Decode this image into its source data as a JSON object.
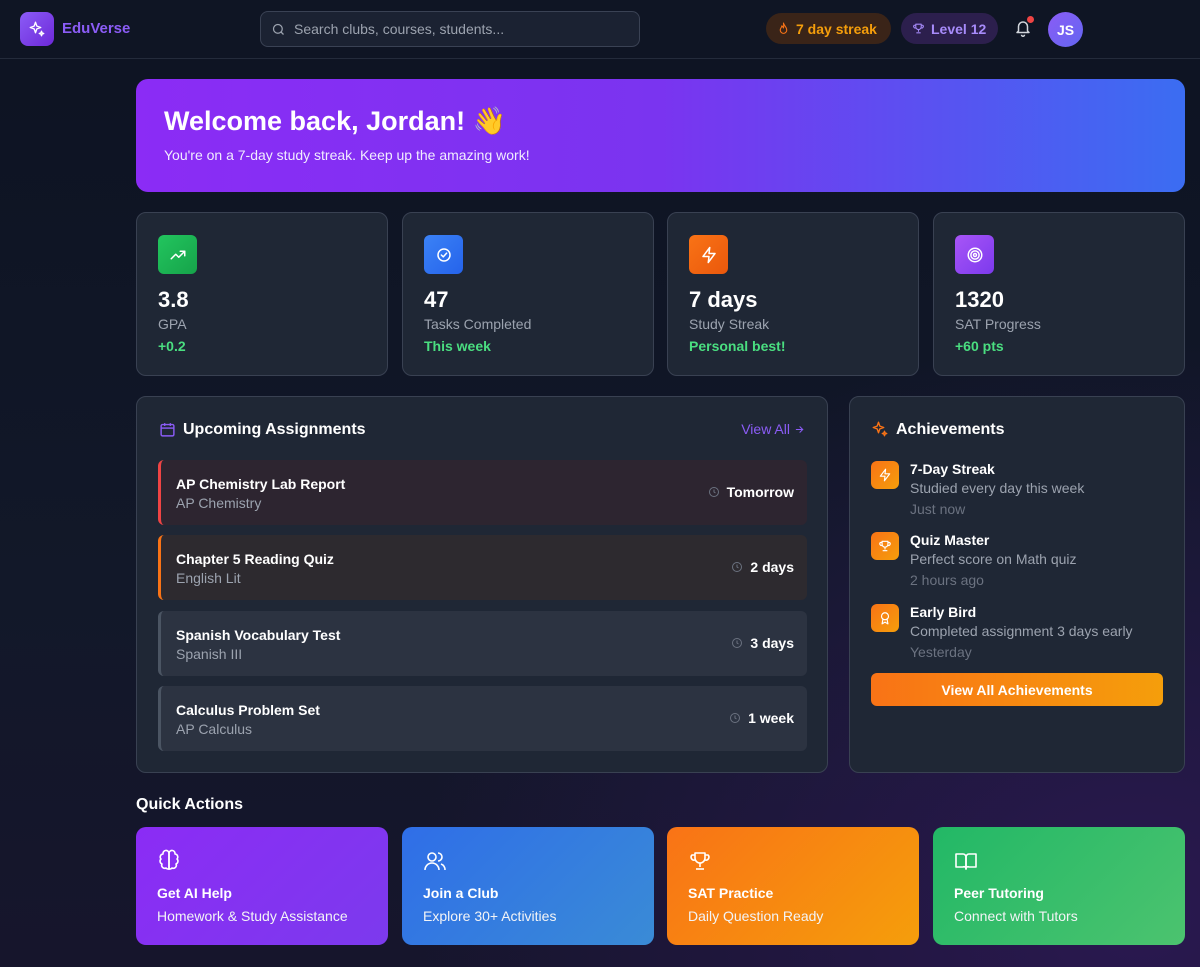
{
  "app": {
    "name": "EduVerse"
  },
  "search": {
    "placeholder": "Search clubs, courses, students..."
  },
  "header": {
    "streak": "7 day streak",
    "level": "Level 12",
    "avatar_initials": "JS"
  },
  "welcome": {
    "title": "Welcome back, Jordan! 👋",
    "subtitle": "You're on a 7-day study streak. Keep up the amazing work!"
  },
  "stats": [
    {
      "icon": "trending-up-icon",
      "color": "#22c55e",
      "value": "3.8",
      "label": "GPA",
      "sub": "+0.2"
    },
    {
      "icon": "check-circle-icon",
      "color": "#3b82f6",
      "value": "47",
      "label": "Tasks Completed",
      "sub": "This week"
    },
    {
      "icon": "lightning-icon",
      "color": "#f97316",
      "value": "7 days",
      "label": "Study Streak",
      "sub": "Personal best!"
    },
    {
      "icon": "target-icon",
      "color": "#8b5cf6",
      "value": "1320",
      "label": "SAT Progress",
      "sub": "+60 pts"
    }
  ],
  "assignments": {
    "title": "Upcoming Assignments",
    "view_all": "View All",
    "items": [
      {
        "title": "AP Chemistry Lab Report",
        "course": "AP Chemistry",
        "due": "Tomorrow",
        "accent": "#ef4444"
      },
      {
        "title": "Chapter 5 Reading Quiz",
        "course": "English Lit",
        "due": "2 days",
        "accent": "#f97316"
      },
      {
        "title": "Spanish Vocabulary Test",
        "course": "Spanish III",
        "due": "3 days",
        "accent": "#4b5563"
      },
      {
        "title": "Calculus Problem Set",
        "course": "AP Calculus",
        "due": "1 week",
        "accent": "#4b5563"
      }
    ]
  },
  "achievements": {
    "title": "Achievements",
    "items": [
      {
        "icon": "lightning-icon",
        "title": "7-Day Streak",
        "desc": "Studied every day this week",
        "when": "Just now"
      },
      {
        "icon": "trophy-icon",
        "title": "Quiz Master",
        "desc": "Perfect score on Math quiz",
        "when": "2 hours ago"
      },
      {
        "icon": "award-icon",
        "title": "Early Bird",
        "desc": "Completed assignment 3 days early",
        "when": "Yesterday"
      }
    ],
    "button": "View All Achievements"
  },
  "quick_actions": {
    "title": "Quick Actions",
    "items": [
      {
        "icon": "brain-icon",
        "title": "Get AI Help",
        "sub": "Homework & Study Assistance"
      },
      {
        "icon": "users-icon",
        "title": "Join a Club",
        "sub": "Explore 30+ Activities"
      },
      {
        "icon": "trophy-icon",
        "title": "SAT Practice",
        "sub": "Daily Question Ready"
      },
      {
        "icon": "book-icon",
        "title": "Peer Tutoring",
        "sub": "Connect with Tutors"
      }
    ]
  }
}
